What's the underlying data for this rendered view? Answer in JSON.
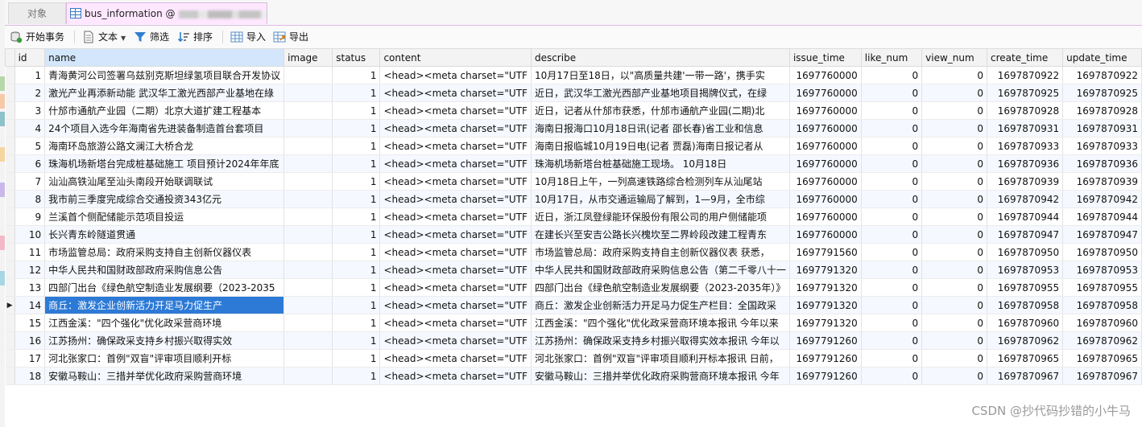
{
  "tabs": {
    "objects_label": "对象",
    "active_label": "bus_information @"
  },
  "toolbar": {
    "begin_transaction": "开始事务",
    "text": "文本",
    "filter": "筛选",
    "sort": "排序",
    "import": "导入",
    "export": "导出"
  },
  "columns": [
    "id",
    "name",
    "image",
    "status",
    "content",
    "describe",
    "issue_time",
    "like_num",
    "view_num",
    "create_time",
    "update_time"
  ],
  "selected_row_index": 13,
  "rows": [
    {
      "id": "1",
      "name": "青海黄河公司签署乌兹别克斯坦绿氢项目联合开发协议",
      "image": "",
      "status": "1",
      "content": "<head><meta charset=\"UTF",
      "describe": "10月17日至18日，以\"高质量共建'一带一路'，携手实",
      "issue_time": "1697760000",
      "like_num": "0",
      "view_num": "0",
      "create_time": "1697870922",
      "update_time": "1697870922"
    },
    {
      "id": "2",
      "name": "激光产业再添新动能 武汉华工激光西部产业基地在綠",
      "image": "",
      "status": "1",
      "content": "<head><meta charset=\"UTF",
      "describe": "近日，武汉华工激光西部产业基地项目揭牌仪式，在绿",
      "issue_time": "1697760000",
      "like_num": "0",
      "view_num": "0",
      "create_time": "1697870925",
      "update_time": "1697870925"
    },
    {
      "id": "3",
      "name": "什邡市通航产业园（二期）北京大道扩建工程基本",
      "image": "",
      "status": "1",
      "content": "<head><meta charset=\"UTF",
      "describe": "近日，记者从什邡市获悉，什邡市通航产业园(二期)北",
      "issue_time": "1697760000",
      "like_num": "0",
      "view_num": "0",
      "create_time": "1697870928",
      "update_time": "1697870928"
    },
    {
      "id": "4",
      "name": "24个项目入选今年海南省先进装备制造首台套项目",
      "image": "",
      "status": "1",
      "content": "<head><meta charset=\"UTF",
      "describe": "海南日报海口10月18日讯(记者 邵长春)省工业和信息",
      "issue_time": "1697760000",
      "like_num": "0",
      "view_num": "0",
      "create_time": "1697870931",
      "update_time": "1697870931"
    },
    {
      "id": "5",
      "name": "海南环岛旅游公路文澜江大桥合龙",
      "image": "",
      "status": "1",
      "content": "<head><meta charset=\"UTF",
      "describe": "海南日报临城10月19日电(记者 贾磊)海南日报记者从",
      "issue_time": "1697760000",
      "like_num": "0",
      "view_num": "0",
      "create_time": "1697870933",
      "update_time": "1697870933"
    },
    {
      "id": "6",
      "name": "珠海机场新塔台完成桩基础施工 项目预计2024年年底",
      "image": "",
      "status": "1",
      "content": "<head><meta charset=\"UTF",
      "describe": "珠海机场新塔台桩基础施工现场。    10月18日",
      "issue_time": "1697760000",
      "like_num": "0",
      "view_num": "0",
      "create_time": "1697870936",
      "update_time": "1697870936"
    },
    {
      "id": "7",
      "name": "汕汕高铁汕尾至汕头南段开始联调联试",
      "image": "",
      "status": "1",
      "content": "<head><meta charset=\"UTF",
      "describe": "10月18日上午，一列高速铁路综合检测列车从汕尾站",
      "issue_time": "1697760000",
      "like_num": "0",
      "view_num": "0",
      "create_time": "1697870939",
      "update_time": "1697870939"
    },
    {
      "id": "8",
      "name": "我市前三季度完成综合交通投资343亿元",
      "image": "",
      "status": "1",
      "content": "<head><meta charset=\"UTF",
      "describe": "10月17日，从市交通运输局了解到，1—9月，全市综",
      "issue_time": "1697760000",
      "like_num": "0",
      "view_num": "0",
      "create_time": "1697870942",
      "update_time": "1697870942"
    },
    {
      "id": "9",
      "name": "兰溪首个侧配储能示范项目投运",
      "image": "",
      "status": "1",
      "content": "<head><meta charset=\"UTF",
      "describe": "近日，浙江凤登绿能环保股份有限公司的用户侧储能项",
      "issue_time": "1697760000",
      "like_num": "0",
      "view_num": "0",
      "create_time": "1697870944",
      "update_time": "1697870944"
    },
    {
      "id": "10",
      "name": "长兴青东岭隧道贯通",
      "image": "",
      "status": "1",
      "content": "<head><meta charset=\"UTF",
      "describe": "在建长兴至安吉公路长兴槐坎至二界岭段改建工程青东",
      "issue_time": "1697760000",
      "like_num": "0",
      "view_num": "0",
      "create_time": "1697870947",
      "update_time": "1697870947"
    },
    {
      "id": "11",
      "name": "市场监管总局：政府采购支持自主创新仪器仪表",
      "image": "",
      "status": "1",
      "content": "<head><meta charset=\"UTF",
      "describe": "市场监管总局：政府采购支持自主创新仪器仪表  获悉，",
      "issue_time": "1697791560",
      "like_num": "0",
      "view_num": "0",
      "create_time": "1697870950",
      "update_time": "1697870950"
    },
    {
      "id": "12",
      "name": "中华人民共和国财政部政府采购信息公告",
      "image": "",
      "status": "1",
      "content": "<head><meta charset=\"UTF",
      "describe": "中华人民共和国财政部政府采购信息公告（第二千零八十一",
      "issue_time": "1697791320",
      "like_num": "0",
      "view_num": "0",
      "create_time": "1697870953",
      "update_time": "1697870953"
    },
    {
      "id": "13",
      "name": "四部门出台《绿色航空制造业发展纲要（2023-2035",
      "image": "",
      "status": "1",
      "content": "<head><meta charset=\"UTF",
      "describe": "四部门出台《绿色航空制造业发展纲要（2023-2035年）》",
      "issue_time": "1697791320",
      "like_num": "0",
      "view_num": "0",
      "create_time": "1697870955",
      "update_time": "1697870955"
    },
    {
      "id": "14",
      "name": "商丘：激发企业创新活力开足马力促生产",
      "image": "",
      "status": "1",
      "content": "<head><meta charset=\"UTF",
      "describe": "商丘：激发企业创新活力开足马力促生产栏目：全国政采",
      "issue_time": "1697791320",
      "like_num": "0",
      "view_num": "0",
      "create_time": "1697870958",
      "update_time": "1697870958"
    },
    {
      "id": "15",
      "name": "江西金溪：\"四个强化\"优化政采营商环境",
      "image": "",
      "status": "1",
      "content": "<head><meta charset=\"UTF",
      "describe": "江西金溪：\"四个强化\"优化政采营商环境本报讯 今年以来",
      "issue_time": "1697791320",
      "like_num": "0",
      "view_num": "0",
      "create_time": "1697870960",
      "update_time": "1697870960"
    },
    {
      "id": "16",
      "name": "江苏扬州：确保政采支持乡村振兴取得实效",
      "image": "",
      "status": "1",
      "content": "<head><meta charset=\"UTF",
      "describe": "江苏扬州：确保政采支持乡村振兴取得实效本报讯 今年以",
      "issue_time": "1697791260",
      "like_num": "0",
      "view_num": "0",
      "create_time": "1697870962",
      "update_time": "1697870962"
    },
    {
      "id": "17",
      "name": "河北张家口：首例\"双盲\"评审项目顺利开标",
      "image": "",
      "status": "1",
      "content": "<head><meta charset=\"UTF",
      "describe": "河北张家口：首例\"双盲\"评审项目顺利开标本报讯 日前，",
      "issue_time": "1697791260",
      "like_num": "0",
      "view_num": "0",
      "create_time": "1697870965",
      "update_time": "1697870965"
    },
    {
      "id": "18",
      "name": "安徽马鞍山：三措并举优化政府采购营商环境",
      "image": "",
      "status": "1",
      "content": "<head><meta charset=\"UTF",
      "describe": "安徽马鞍山：三措并举优化政府采购营商环境本报讯 今年",
      "issue_time": "1697791260",
      "like_num": "0",
      "view_num": "0",
      "create_time": "1697870967",
      "update_time": "1697870967"
    }
  ],
  "watermark": "CSDN @抄代码抄错的小牛马"
}
